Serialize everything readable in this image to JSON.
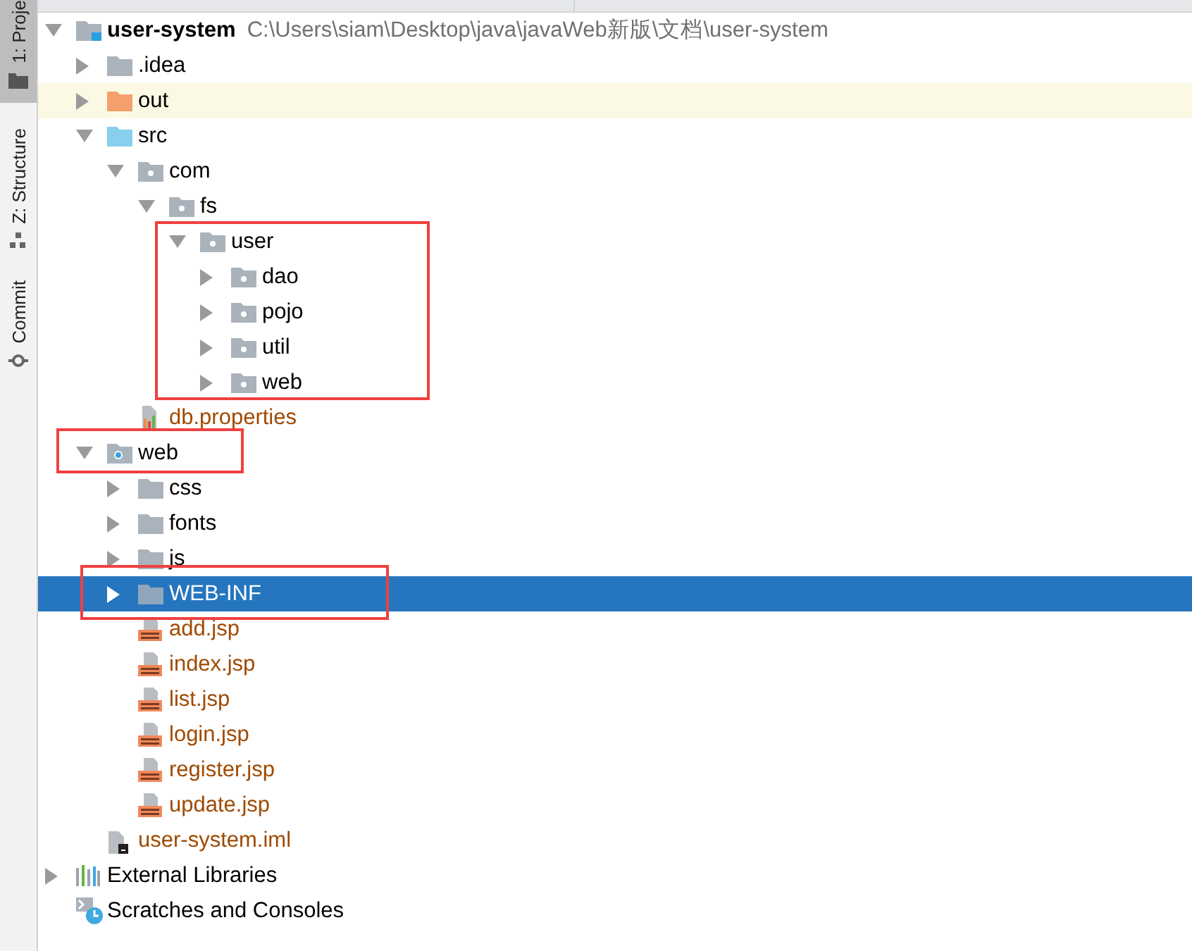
{
  "tool_strip": {
    "tabs": [
      {
        "label": "1: Proje",
        "selected": true
      },
      {
        "label": "Z: Structure",
        "selected": false
      },
      {
        "label": "Commit",
        "selected": false
      }
    ]
  },
  "tree": [
    {
      "name": "user-system",
      "path": "C:\\Users\\siam\\Desktop\\java\\javaWeb新版\\文档\\user-system",
      "kind": "project",
      "expanded": true,
      "selected": false,
      "boxed": false,
      "children": [
        {
          "name": ".idea",
          "kind": "folder",
          "expanded": false,
          "selected": false,
          "boxed": false
        },
        {
          "name": "out",
          "kind": "excluded",
          "expanded": false,
          "selected": false,
          "boxed": false
        },
        {
          "name": "src",
          "kind": "source",
          "expanded": true,
          "selected": false,
          "boxed": false,
          "children": [
            {
              "name": "com",
              "kind": "package",
              "expanded": true,
              "selected": false,
              "boxed": false,
              "children": [
                {
                  "name": "fs",
                  "kind": "package",
                  "expanded": true,
                  "selected": false,
                  "boxed": false,
                  "children": [
                    {
                      "name": "user",
                      "kind": "package",
                      "expanded": true,
                      "selected": false,
                      "boxed": true,
                      "children": [
                        {
                          "name": "dao",
                          "kind": "package",
                          "expanded": false,
                          "selected": false,
                          "boxed": false
                        },
                        {
                          "name": "pojo",
                          "kind": "package",
                          "expanded": false,
                          "selected": false,
                          "boxed": false
                        },
                        {
                          "name": "util",
                          "kind": "package",
                          "expanded": false,
                          "selected": false,
                          "boxed": false
                        },
                        {
                          "name": "web",
                          "kind": "package",
                          "expanded": false,
                          "selected": false,
                          "boxed": false
                        }
                      ]
                    }
                  ]
                }
              ]
            },
            {
              "name": "db.properties",
              "kind": "properties",
              "selected": false,
              "boxed": false
            }
          ]
        },
        {
          "name": "web",
          "kind": "web",
          "expanded": true,
          "selected": false,
          "boxed": true,
          "children": [
            {
              "name": "css",
              "kind": "folder",
              "expanded": false,
              "selected": false,
              "boxed": false
            },
            {
              "name": "fonts",
              "kind": "folder",
              "expanded": false,
              "selected": false,
              "boxed": false
            },
            {
              "name": "js",
              "kind": "folder",
              "expanded": false,
              "selected": false,
              "boxed": false
            },
            {
              "name": "WEB-INF",
              "kind": "folder",
              "expanded": false,
              "selected": true,
              "boxed": true
            },
            {
              "name": "add.jsp",
              "kind": "jsp",
              "selected": false,
              "boxed": false
            },
            {
              "name": "index.jsp",
              "kind": "jsp",
              "selected": false,
              "boxed": false
            },
            {
              "name": "list.jsp",
              "kind": "jsp",
              "selected": false,
              "boxed": false
            },
            {
              "name": "login.jsp",
              "kind": "jsp",
              "selected": false,
              "boxed": false
            },
            {
              "name": "register.jsp",
              "kind": "jsp",
              "selected": false,
              "boxed": false
            },
            {
              "name": "update.jsp",
              "kind": "jsp",
              "selected": false,
              "boxed": false
            }
          ]
        },
        {
          "name": "user-system.iml",
          "kind": "iml",
          "selected": false,
          "boxed": false
        }
      ]
    },
    {
      "name": "External Libraries",
      "kind": "libraries",
      "expanded": false,
      "selected": false,
      "boxed": false
    },
    {
      "name": "Scratches and Consoles",
      "kind": "scratches",
      "selected": false,
      "boxed": false
    }
  ]
}
